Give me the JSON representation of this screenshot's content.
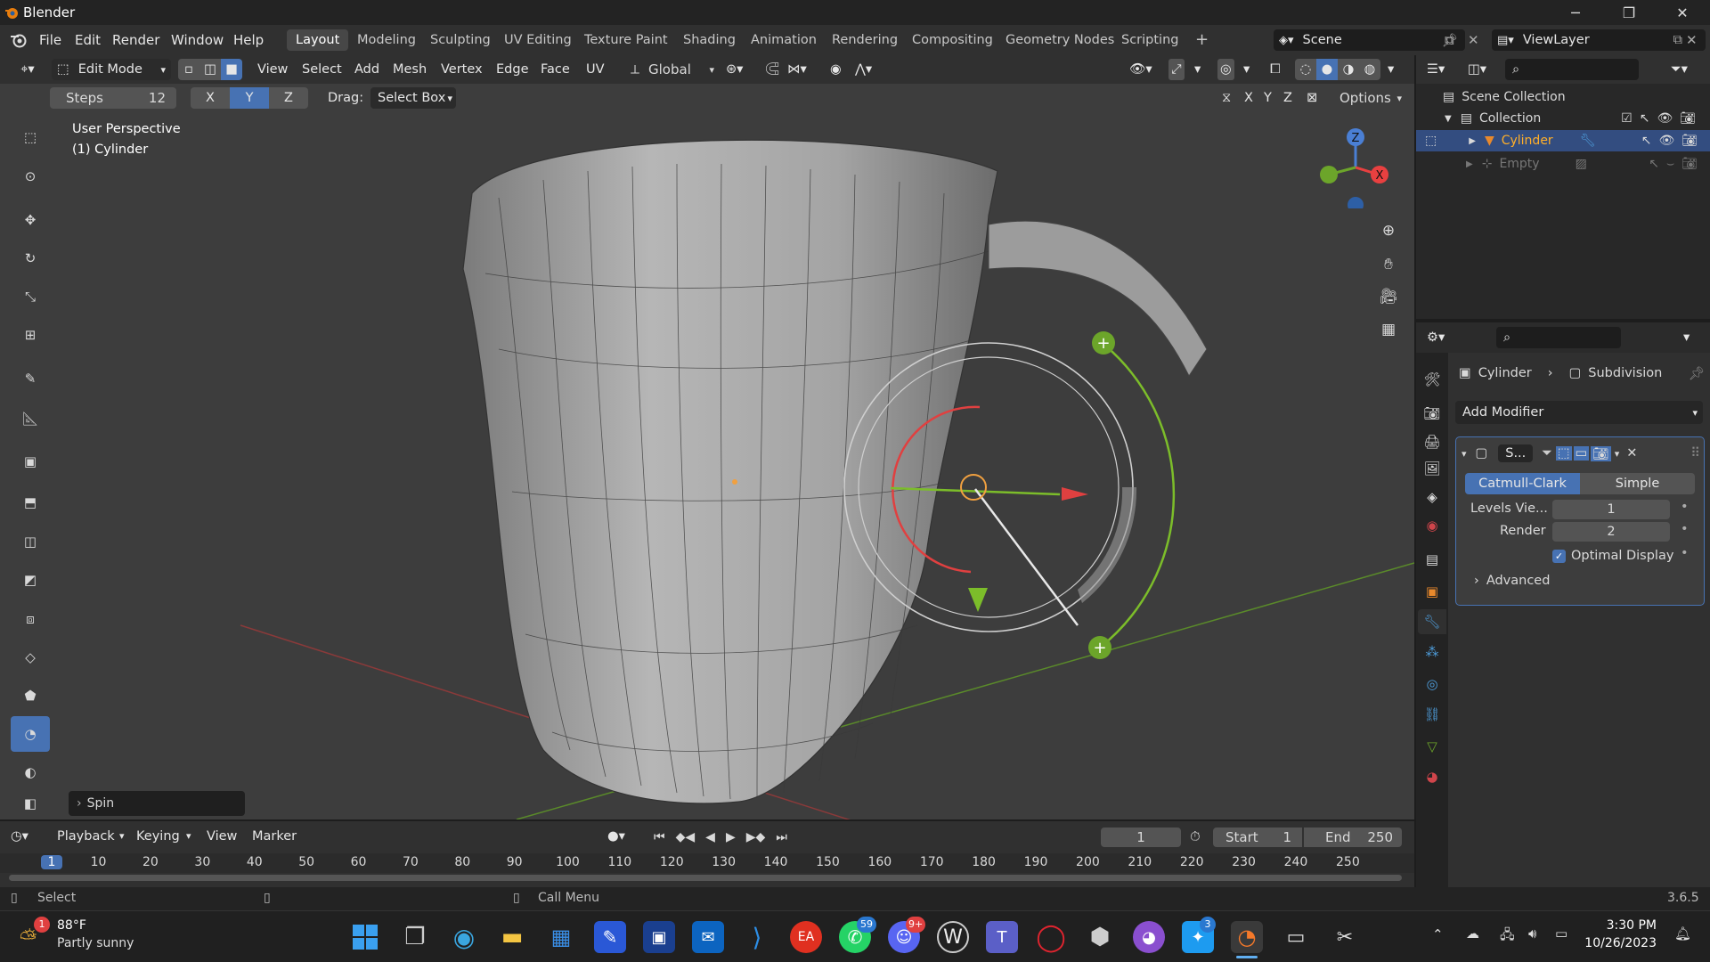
{
  "app": {
    "title": "Blender",
    "version": "3.6.5"
  },
  "menu": [
    "File",
    "Edit",
    "Render",
    "Window",
    "Help"
  ],
  "workspaces": [
    "Layout",
    "Modeling",
    "Sculpting",
    "UV Editing",
    "Texture Paint",
    "Shading",
    "Animation",
    "Rendering",
    "Compositing",
    "Geometry Nodes",
    "Scripting"
  ],
  "active_workspace": "Layout",
  "scene": {
    "name": "Scene",
    "viewlayer": "ViewLayer"
  },
  "viewport_header": {
    "mode": "Edit Mode",
    "menus": [
      "View",
      "Select",
      "Add",
      "Mesh",
      "Vertex",
      "Edge",
      "Face",
      "UV"
    ],
    "orientation": "Global"
  },
  "tool_settings": {
    "steps_label": "Steps",
    "steps_value": "12",
    "axes": [
      "X",
      "Y",
      "Z"
    ],
    "active_axis": "Y",
    "drag_label": "Drag:",
    "drag_value": "Select Box",
    "options_label": "Options",
    "mirror_axes": [
      "X",
      "Y",
      "Z"
    ]
  },
  "viewport": {
    "perspective": "User Perspective",
    "object": "(1) Cylinder",
    "last_op": "Spin",
    "gizmo_axes": [
      "Z",
      "X"
    ]
  },
  "outliner": {
    "root": "Scene Collection",
    "collection": "Collection",
    "items": [
      "Cylinder",
      "Empty"
    ]
  },
  "properties": {
    "breadcrumb_object": "Cylinder",
    "breadcrumb_modifier": "Subdivision",
    "add_modifier": "Add Modifier",
    "modifier_name": "S...",
    "tabs": [
      "Catmull-Clark",
      "Simple"
    ],
    "active_tab": "Catmull-Clark",
    "levels_label": "Levels Vie...",
    "levels_value": "1",
    "render_label": "Render",
    "render_value": "2",
    "optimal_display": "Optimal Display",
    "advanced": "Advanced"
  },
  "timeline": {
    "menus": [
      "Playback",
      "Keying",
      "View",
      "Marker"
    ],
    "current_frame": "1",
    "start_label": "Start",
    "start_value": "1",
    "end_label": "End",
    "end_value": "250",
    "ruler": [
      "1",
      "10",
      "20",
      "30",
      "40",
      "50",
      "60",
      "70",
      "80",
      "90",
      "100",
      "110",
      "120",
      "130",
      "140",
      "150",
      "160",
      "170",
      "180",
      "190",
      "200",
      "210",
      "220",
      "230",
      "240",
      "250"
    ]
  },
  "status": {
    "left": "Select",
    "middle": "Call Menu",
    "version": "3.6.5"
  },
  "taskbar": {
    "weather_temp": "88°F",
    "weather_desc": "Partly sunny",
    "weather_badge": "1",
    "time": "3:30 PM",
    "date": "10/26/2023",
    "badges": {
      "whatsapp": "59",
      "discord": "9+",
      "twitter": "3"
    }
  },
  "colors": {
    "accent": "#4772b3",
    "green": "#6ca52a",
    "red": "#e8404e"
  }
}
